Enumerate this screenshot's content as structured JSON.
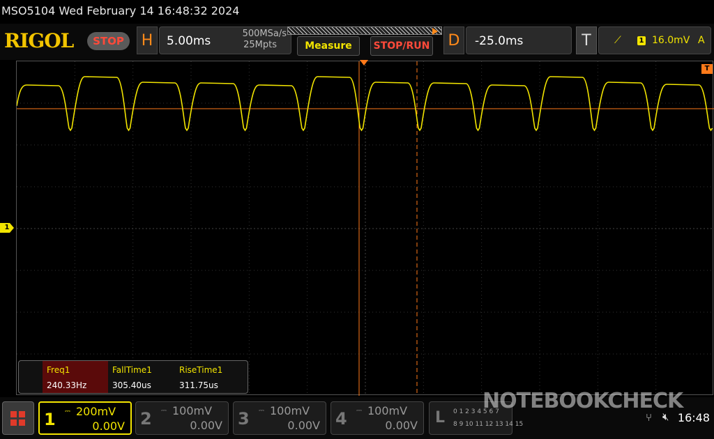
{
  "title_bar": {
    "text": "MSO5104  Wed February 14 16:48:32 2024"
  },
  "brand": {
    "logo": "RIGOL",
    "run_state": "STOP"
  },
  "horizontal": {
    "letter": "H",
    "timebase": "5.00ms",
    "sample_rate": "500MSa/s",
    "memory_depth": "25Mpts"
  },
  "buttons": {
    "measure": "Measure",
    "stop_run": "STOP/RUN"
  },
  "delay": {
    "letter": "D",
    "value": "-25.0ms"
  },
  "trigger": {
    "letter": "T",
    "source": "1",
    "level": "16.0mV",
    "mode": "A"
  },
  "markers": {
    "ch1": "1"
  },
  "measurements": [
    {
      "name": "Freq1",
      "value": "240.33Hz"
    },
    {
      "name": "FallTime1",
      "value": "305.40us"
    },
    {
      "name": "RiseTime1",
      "value": "311.75us"
    }
  ],
  "channels": [
    {
      "num": "1",
      "scale": "200mV",
      "offset": "0.00V",
      "active": true
    },
    {
      "num": "2",
      "scale": "100mV",
      "offset": "0.00V",
      "active": false
    },
    {
      "num": "3",
      "scale": "100mV",
      "offset": "0.00V",
      "active": false
    },
    {
      "num": "4",
      "scale": "100mV",
      "offset": "0.00V",
      "active": false
    }
  ],
  "logic": {
    "letter": "L",
    "row1": "0 1 2 3 4 5 6 7",
    "row2": "8 9 10 11 12 13 14 15"
  },
  "status": {
    "time": "16:48"
  },
  "watermark": "NOTEBOOKCHECK",
  "colors": {
    "ch1": "#f2e400",
    "trigger_line": "#ff7a1a",
    "stop": "#ff4a3a",
    "grid": "#333333"
  }
}
